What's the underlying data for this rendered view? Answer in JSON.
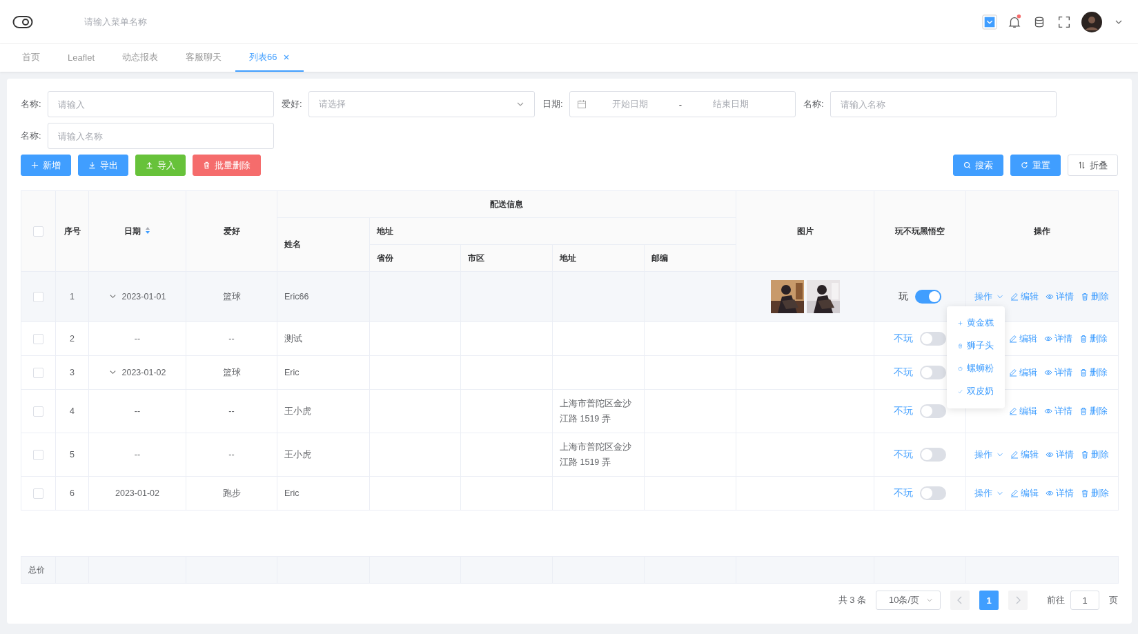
{
  "header": {
    "search": {
      "placeholder": "请输入菜单名称"
    },
    "notification_dot": true
  },
  "tabs": [
    {
      "label": "首页",
      "selected": false,
      "closable": false
    },
    {
      "label": "Leaflet",
      "selected": false,
      "closable": false
    },
    {
      "label": "动态报表",
      "selected": false,
      "closable": false
    },
    {
      "label": "客服聊天",
      "selected": false,
      "closable": false
    },
    {
      "label": "列表66",
      "selected": true,
      "closable": true
    }
  ],
  "filters": [
    {
      "kind": "input",
      "label": "名称:",
      "placeholder": "请输入"
    },
    {
      "kind": "select",
      "label": "爱好:",
      "placeholder": "请选择"
    },
    {
      "kind": "daterange",
      "label": "日期:",
      "start_placeholder": "开始日期",
      "separator": "-",
      "end_placeholder": "结束日期"
    },
    {
      "kind": "input",
      "label": "名称:",
      "placeholder": "请输入名称"
    },
    {
      "kind": "input",
      "label": "名称:",
      "placeholder": "请输入名称"
    }
  ],
  "actions": [
    {
      "kind": "add",
      "label": "新增",
      "color": "#409eff"
    },
    {
      "kind": "export",
      "label": "导出",
      "color": "#409eff"
    },
    {
      "kind": "import",
      "label": "导入",
      "color": "#67c23a"
    },
    {
      "kind": "delete",
      "label": "批量删除",
      "color": "#f56c6c"
    }
  ],
  "tools": [
    {
      "kind": "search",
      "label": "搜索",
      "primary": true
    },
    {
      "kind": "reset",
      "label": "重置",
      "primary": true
    },
    {
      "kind": "fold",
      "label": "折叠",
      "primary": false
    }
  ],
  "table": {
    "all_selected": false,
    "columns": {
      "index": "序号",
      "date": "日期",
      "hobby": "爱好",
      "delivery": "配送信息",
      "name": "姓名",
      "address_group": "地址",
      "province": "省份",
      "city": "市区",
      "address": "地址",
      "zip": "邮编",
      "images": "图片",
      "play": "玩不玩黑悟空",
      "ops": "操作"
    },
    "rows": [
      {
        "selected": false,
        "hovered": true,
        "index": "1",
        "expandable": true,
        "date": "2023-01-01",
        "hobby": "篮球",
        "name": "Eric66",
        "address": "",
        "play": {
          "label": "玩",
          "on": true
        },
        "menu_label": "操作",
        "edit": "编辑",
        "detail": "详情",
        "remove": "删除"
      },
      {
        "selected": false,
        "hovered": false,
        "index": "2",
        "expandable": false,
        "date": "--",
        "hobby": "--",
        "name": "测试",
        "address": "",
        "images": [],
        "play": {
          "label": "不玩",
          "on": false
        },
        "edit": "编辑",
        "detail": "详情",
        "remove": "删除"
      },
      {
        "selected": false,
        "hovered": false,
        "index": "3",
        "expandable": true,
        "date": "2023-01-02",
        "hobby": "篮球",
        "name": "Eric",
        "address": "",
        "images": [],
        "play": {
          "label": "不玩",
          "on": false
        },
        "edit": "编辑",
        "detail": "详情",
        "remove": "删除"
      },
      {
        "selected": false,
        "hovered": false,
        "index": "4",
        "expandable": false,
        "date": "--",
        "hobby": "--",
        "name": "王小虎",
        "address": "上海市普陀区金沙江路 1519 弄",
        "images": [],
        "play": {
          "label": "不玩",
          "on": false
        },
        "edit": "编辑",
        "detail": "详情",
        "remove": "删除"
      },
      {
        "selected": false,
        "hovered": false,
        "index": "5",
        "expandable": false,
        "date": "--",
        "hobby": "--",
        "name": "王小虎",
        "address": "上海市普陀区金沙江路 1519 弄",
        "images": [],
        "play": {
          "label": "不玩",
          "on": false
        },
        "menu_label": "操作",
        "edit": "编辑",
        "detail": "详情",
        "remove": "删除"
      },
      {
        "selected": false,
        "hovered": false,
        "index": "6",
        "expandable": false,
        "date": "2023-01-02",
        "hobby": "跑步",
        "name": "Eric",
        "address": "",
        "images": [],
        "play": {
          "label": "不玩",
          "on": false
        },
        "menu_label": "操作",
        "edit": "编辑",
        "detail": "详情",
        "remove": "删除"
      }
    ],
    "summary_label": "总价"
  },
  "dropdown": [
    {
      "kind": "plus",
      "label": "黄金糕"
    },
    {
      "kind": "cup",
      "label": "狮子头"
    },
    {
      "kind": "apple",
      "label": "螺蛳粉"
    },
    {
      "kind": "check",
      "label": "双皮奶"
    }
  ],
  "pagination": {
    "total": "共 3 条",
    "page_size": "10条/页",
    "pages": [
      {
        "label": "1",
        "selected": true
      }
    ],
    "goto_label": "前往",
    "goto_value": "1",
    "goto_suffix": "页"
  }
}
